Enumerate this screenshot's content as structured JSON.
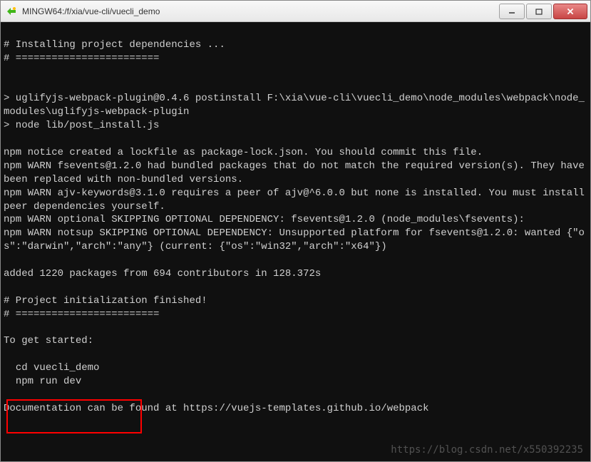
{
  "window": {
    "title": "MINGW64:/f/xia/vue-cli/vuecli_demo"
  },
  "terminal": {
    "line_blank1": "",
    "line_install1": "# Installing project dependencies ...",
    "line_install2": "# ========================",
    "line_blank2": "",
    "line_blank3": "",
    "line_uglify1": "> uglifyjs-webpack-plugin@0.4.6 postinstall F:\\xia\\vue-cli\\vuecli_demo\\node_modules\\webpack\\node_modules\\uglifyjs-webpack-plugin",
    "line_uglify2": "> node lib/post_install.js",
    "line_blank4": "",
    "line_notice": "npm notice created a lockfile as package-lock.json. You should commit this file.",
    "line_warn1": "npm WARN fsevents@1.2.0 had bundled packages that do not match the required version(s). They have been replaced with non-bundled versions.",
    "line_warn2": "npm WARN ajv-keywords@3.1.0 requires a peer of ajv@^6.0.0 but none is installed. You must install peer dependencies yourself.",
    "line_warn3": "npm WARN optional SKIPPING OPTIONAL DEPENDENCY: fsevents@1.2.0 (node_modules\\fsevents):",
    "line_warn4": "npm WARN notsup SKIPPING OPTIONAL DEPENDENCY: Unsupported platform for fsevents@1.2.0: wanted {\"os\":\"darwin\",\"arch\":\"any\"} (current: {\"os\":\"win32\",\"arch\":\"x64\"})",
    "line_blank5": "",
    "line_added": "added 1220 packages from 694 contributors in 128.372s",
    "line_blank6": "",
    "line_proj1": "# Project initialization finished!",
    "line_proj2": "# ========================",
    "line_blank7": "",
    "line_start": "To get started:",
    "line_blank8": "",
    "line_cd": "  cd vuecli_demo",
    "line_run": "  npm run dev",
    "line_blank9": "",
    "line_docs": "Documentation can be found at https://vuejs-templates.github.io/webpack"
  },
  "watermark": "https://blog.csdn.net/x550392235"
}
